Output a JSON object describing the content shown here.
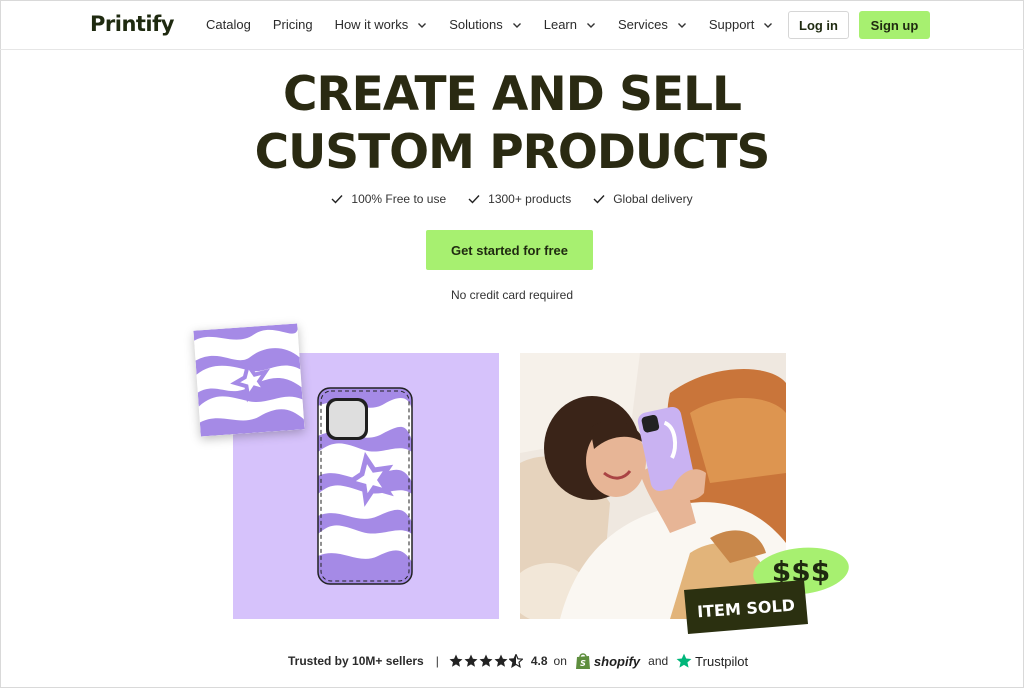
{
  "nav": {
    "logo": "Printify",
    "items": [
      {
        "label": "Catalog",
        "dropdown": false
      },
      {
        "label": "Pricing",
        "dropdown": false
      },
      {
        "label": "How it works",
        "dropdown": true
      },
      {
        "label": "Solutions",
        "dropdown": true
      },
      {
        "label": "Learn",
        "dropdown": true
      },
      {
        "label": "Services",
        "dropdown": true
      },
      {
        "label": "Support",
        "dropdown": true
      }
    ],
    "login_label": "Log in",
    "signup_label": "Sign up"
  },
  "hero": {
    "headline_line1": "CREATE AND SELL",
    "headline_line2": "CUSTOM PRODUCTS",
    "features": [
      "100% Free to use",
      "1300+ products",
      "Global delivery"
    ],
    "cta_label": "Get started for free",
    "cta_note": "No credit card required"
  },
  "badges": {
    "money": "$$$",
    "sold": "ITEM SOLD"
  },
  "trust": {
    "sellers": "Trusted by 10M+ sellers",
    "separator": "|",
    "stars": 4.5,
    "rating": "4.8",
    "on": "on",
    "shopify": "shopify",
    "and": "and",
    "trustpilot": "Trustpilot"
  },
  "colors": {
    "accent_green": "#a7f070",
    "dark_text": "#2a2a12",
    "lavender": "#d6c2fb",
    "swirl_purple": "#a58ae6",
    "badge_dark": "#2b3010"
  },
  "icons": [
    "check-icon",
    "chevron-down-icon",
    "star-icon",
    "shopify-bag-icon",
    "trustpilot-star-icon"
  ]
}
